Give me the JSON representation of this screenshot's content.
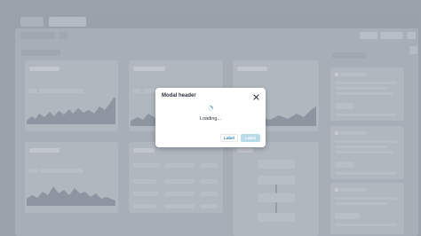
{
  "modal": {
    "header": "Modal header",
    "status_text": "Loading...",
    "buttons": {
      "secondary_label": "Label",
      "primary_label": "Label"
    },
    "icons": {
      "close": "close-icon",
      "spinner": "spinner-icon"
    }
  },
  "colors": {
    "overlay": "#7c8490",
    "accent": "#2f7fa8",
    "primary_disabled": "#b9dbe9",
    "text": "#2b3440"
  }
}
